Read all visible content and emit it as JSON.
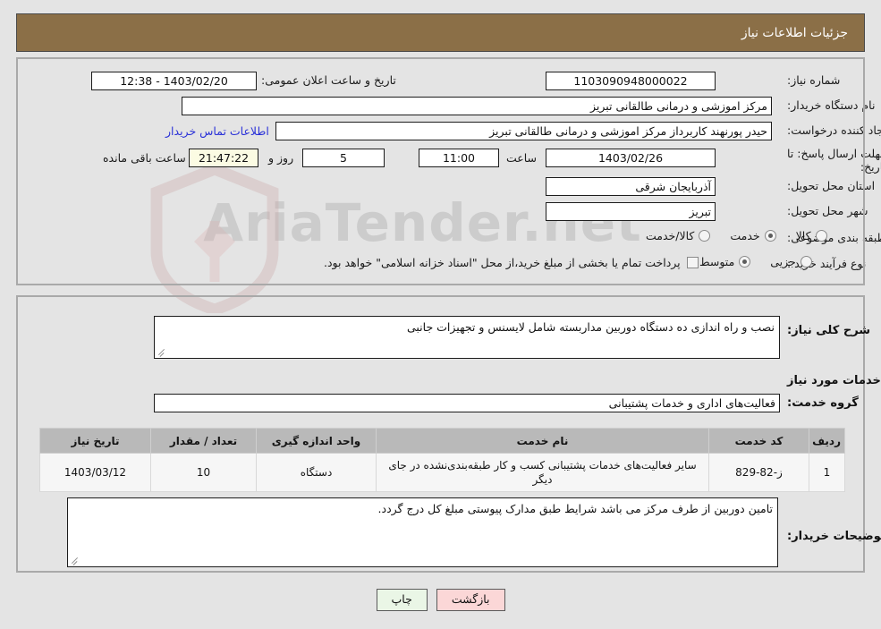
{
  "header": {
    "title": "جزئیات اطلاعات نیاز",
    "bg_color": "#8b6f47"
  },
  "watermark": {
    "text": "AriaTender.net"
  },
  "info": {
    "need_number_label": "شماره نیاز:",
    "need_number_value": "1103090948000022",
    "announce_label": "تاریخ و ساعت اعلان عمومی:",
    "announce_value": "1403/02/20 - 12:38",
    "buyer_org_label": "نام دستگاه خریدار:",
    "buyer_org_value": "مرکز اموزشی و درمانی طالقانی تبریز",
    "creator_label": "ایجاد کننده درخواست:",
    "creator_value": "حیدر پورنهند کاربرداز مرکز اموزشی و درمانی طالقانی تبریز",
    "contact_link": "اطلاعات تماس خریدار",
    "deadline_label_line1": "مهلت ارسال پاسخ: تا",
    "deadline_label_line2": "تاریخ:",
    "deadline_date": "1403/02/26",
    "hour_label": "ساعت",
    "hour_value": "11:00",
    "days_value": "5",
    "days_label": "روز و",
    "countdown_value": "21:47:22",
    "countdown_label": "ساعت باقی مانده",
    "province_label": "استان محل تحویل:",
    "province_value": "آذربایجان شرقی",
    "city_label": "شهر محل تحویل:",
    "city_value": "تبریز",
    "category_label": "طبقه بندی موضوعی:",
    "category_options": [
      {
        "label": "کالا",
        "selected": false
      },
      {
        "label": "خدمت",
        "selected": true
      },
      {
        "label": "کالا/خدمت",
        "selected": false
      }
    ],
    "process_label": "نوع فرآیند خرید :",
    "process_options": [
      {
        "label": "جزیی",
        "selected": false
      },
      {
        "label": "متوسط",
        "selected": true
      }
    ],
    "treasury_checkbox_label": "پرداخت تمام یا بخشی از مبلغ خرید،از محل \"اسناد خزانه اسلامی\" خواهد بود.",
    "treasury_checked": false
  },
  "description": {
    "need_summary_label": "شرح کلی نیاز:",
    "need_summary_value": "نصب و راه اندازی ده دستگاه دوربین مداربسته شامل لایسنس و تجهیزات جانبی",
    "services_heading": "اطلاعات خدمات مورد نیاز",
    "service_group_label": "گروه خدمت:",
    "service_group_value": "فعالیت‌های اداری و خدمات پشتیبانی"
  },
  "table": {
    "columns": [
      "ردیف",
      "کد خدمت",
      "نام خدمت",
      "واحد اندازه گیری",
      "تعداد / مقدار",
      "تاریخ نیاز"
    ],
    "rows": [
      {
        "index": "1",
        "code": "ز-82-829",
        "name": "سایر فعالیت‌های خدمات پشتیبانی کسب و کار طبقه‌بندی‌نشده در جای دیگر",
        "unit": "دستگاه",
        "qty": "10",
        "date": "1403/03/12"
      }
    ]
  },
  "buyer_notes": {
    "label": "توضیحات خریدار:",
    "value": "تامین دوربین از طرف مرکز می باشد شرایط طبق مدارک پیوستی مبلغ کل درج گردد."
  },
  "buttons": {
    "back": "بازگشت",
    "print": "چاپ"
  }
}
